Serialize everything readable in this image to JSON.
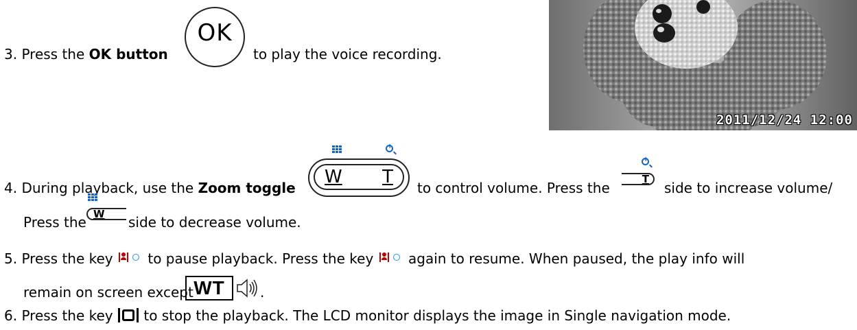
{
  "step3": {
    "number": "3.",
    "text_a": "Press the ",
    "bold": "OK button",
    "text_b": "to play the voice recording.",
    "ok_label": "OK"
  },
  "photo": {
    "timestamp": "2011/12/24 12:00"
  },
  "step4": {
    "number": "4.",
    "text_a": "During playback, use the ",
    "bold": "Zoom toggle",
    "text_b": "to control volume. Press the",
    "text_c": "side to increase volume/",
    "text_d": "Press the",
    "text_e": "side to decrease volume.",
    "w_label": "W",
    "t_label": "T"
  },
  "step5": {
    "number": "5.",
    "text_a": "Press the key",
    "text_b": "to pause playback. Press the key",
    "text_c": "again to resume. When paused, the play info will",
    "text_d": "remain on screen except",
    "wt_label": "WT",
    "text_e": "."
  },
  "step6": {
    "number": "6.",
    "text_a": "Press the key",
    "text_b": "to stop the playback. The LCD monitor displays the image in Single navigation mode."
  },
  "colors": {
    "icon_blue": "#1464c8",
    "icon_red": "#c00000"
  }
}
